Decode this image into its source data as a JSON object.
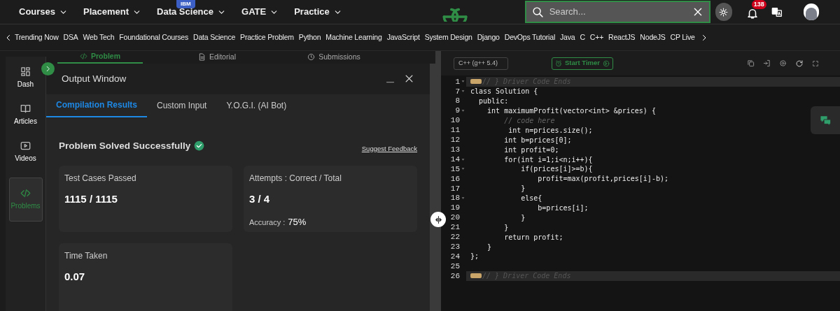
{
  "top_nav": {
    "menus": [
      {
        "label": "Courses"
      },
      {
        "label": "Placement"
      },
      {
        "label": "Data Science",
        "badge": "IBM"
      },
      {
        "label": "GATE"
      },
      {
        "label": "Practice"
      }
    ],
    "search": {
      "placeholder": "Search..."
    },
    "notification_count": "138"
  },
  "category_bar": [
    "Trending Now",
    "DSA",
    "Web Tech",
    "Foundational Courses",
    "Data Science",
    "Practice Problem",
    "Python",
    "Machine Learning",
    "JavaScript",
    "System Design",
    "Django",
    "DevOps Tutorial",
    "Java",
    "C",
    "C++",
    "ReactJS",
    "NodeJS",
    "CP Live"
  ],
  "sidebar": [
    {
      "label": "Dash",
      "selected": false
    },
    {
      "label": "Articles",
      "selected": false
    },
    {
      "label": "Videos",
      "selected": false
    },
    {
      "label": "Problems",
      "selected": true
    }
  ],
  "problem_tabs": [
    {
      "label": "Problem",
      "selected": true
    },
    {
      "label": "Editorial",
      "selected": false
    },
    {
      "label": "Submissions",
      "selected": false
    }
  ],
  "output_window": {
    "title": "Output Window",
    "tabs": [
      {
        "label": "Compilation Results",
        "selected": true
      },
      {
        "label": "Custom Input",
        "selected": false
      },
      {
        "label": "Y.O.G.I. (AI Bot)",
        "selected": false
      }
    ],
    "status": "Problem Solved Successfully",
    "feedback_link": "Suggest Feedback",
    "cards": [
      {
        "title": "Test Cases Passed",
        "value": "1115 / 1115"
      },
      {
        "title": "Attempts : Correct / Total",
        "value": "3 / 4",
        "extra_label": "Accuracy :",
        "extra_value": "75%"
      },
      {
        "title": "Time Taken",
        "value": "0.07"
      }
    ]
  },
  "editor": {
    "language": "C++ (g++ 5.4)",
    "timer_button": "Start Timer",
    "lines": [
      {
        "number": "1",
        "fold": true,
        "kind": "folded",
        "text": "// } Driver Code Ends"
      },
      {
        "number": "7",
        "fold": true,
        "kind": "code",
        "text": "class Solution {"
      },
      {
        "number": "8",
        "fold": false,
        "kind": "code",
        "text": "  public:"
      },
      {
        "number": "9",
        "fold": true,
        "kind": "code",
        "text": "    int maximumProfit(vector<int> &prices) {"
      },
      {
        "number": "10",
        "fold": false,
        "kind": "comment",
        "text": "        // code here"
      },
      {
        "number": "11",
        "fold": false,
        "kind": "code",
        "text": "         int n=prices.size();"
      },
      {
        "number": "12",
        "fold": false,
        "kind": "code",
        "text": "        int b=prices[0];"
      },
      {
        "number": "13",
        "fold": false,
        "kind": "code",
        "text": "        int profit=0;"
      },
      {
        "number": "14",
        "fold": true,
        "kind": "code",
        "text": "        for(int i=1;i<n;i++){"
      },
      {
        "number": "15",
        "fold": true,
        "kind": "code",
        "text": "            if(prices[i]>=b){"
      },
      {
        "number": "16",
        "fold": false,
        "kind": "code",
        "text": "                profit=max(profit,prices[i]-b);"
      },
      {
        "number": "17",
        "fold": false,
        "kind": "code",
        "text": "            }"
      },
      {
        "number": "18",
        "fold": true,
        "kind": "code",
        "text": "            else{"
      },
      {
        "number": "19",
        "fold": false,
        "kind": "code",
        "text": "                b=prices[i];"
      },
      {
        "number": "20",
        "fold": false,
        "kind": "code",
        "text": "            }"
      },
      {
        "number": "21",
        "fold": false,
        "kind": "code",
        "text": "        }"
      },
      {
        "number": "22",
        "fold": false,
        "kind": "code",
        "text": "        return profit;"
      },
      {
        "number": "23",
        "fold": false,
        "kind": "code",
        "text": "    }"
      },
      {
        "number": "24",
        "fold": false,
        "kind": "code",
        "text": "};"
      },
      {
        "number": "25",
        "fold": false,
        "kind": "code"
      },
      {
        "number": "26",
        "fold": false,
        "kind": "folded",
        "text": "// } Driver Code Ends"
      }
    ]
  }
}
